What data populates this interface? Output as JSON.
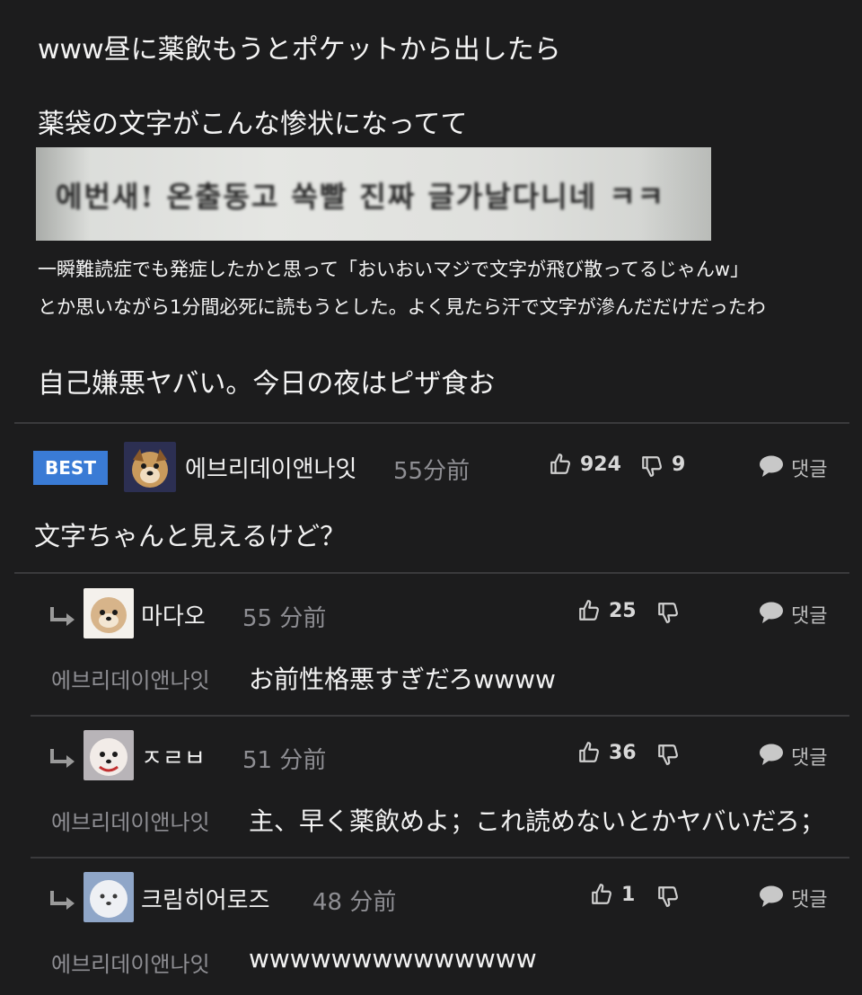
{
  "post": {
    "lines": [
      "www昼に薬飲もうとポケットから出したら",
      "薬袋の文字がこんな惨状になってて",
      "一瞬難読症でも発症したかと思って「おいおいマジで文字が飛び散ってるじゃんw」",
      "とか思いながら1分間必死に読もうとした。よく見たら汗で文字が滲んだだけだったわ",
      "自己嫌悪ヤバい。今日の夜はピザ食お"
    ],
    "photo_text": "에번새! 온출동고 쏙빨 진짜 글가날다니네 ㅋㅋ"
  },
  "best_comment": {
    "badge": "BEST",
    "user": "에브리데이앤나잇",
    "time": "55分前",
    "likes": "924",
    "dislikes": "9",
    "reply_label": "댓글",
    "text": "文字ちゃんと見えるけど？"
  },
  "replies": [
    {
      "user": "마다오",
      "time": "55 分前",
      "likes": "25",
      "reply_label": "댓글",
      "mention": "에브리데이앤나잇",
      "text": "お前性格悪すぎだろwwww"
    },
    {
      "user": "ㅈㄹㅂ",
      "time": "51 分前",
      "likes": "36",
      "reply_label": "댓글",
      "mention": "에브리데이앤나잇",
      "text": "主、早く薬飲めよ；これ読めないとかヤバいだろ；"
    },
    {
      "user": "크림히어로즈",
      "time": "48 分前",
      "likes": "1",
      "reply_label": "댓글",
      "mention": "에브리데이앤나잇",
      "text": "wwwwwwwwwwwwww"
    }
  ],
  "colors": {
    "background": "#1c1c1d",
    "best_badge": "#3a7bd5",
    "muted_text": "#8e8e93",
    "divider": "#3a3a3c"
  },
  "icons": [
    "thumbs-up-icon",
    "thumbs-down-icon",
    "comment-bubble-icon",
    "reply-arrow-icon"
  ]
}
